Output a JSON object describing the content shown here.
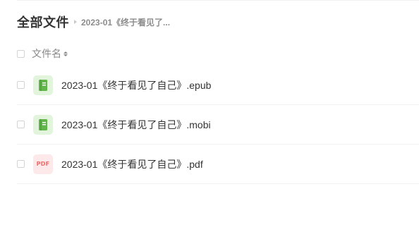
{
  "breadcrumb": {
    "root": "全部文件",
    "current": "2023-01《终于看见了..."
  },
  "table": {
    "name_header": "文件名"
  },
  "files": [
    {
      "name": "2023-01《终于看见了自己》.epub",
      "type": "book-icon"
    },
    {
      "name": "2023-01《终于看见了自己》.mobi",
      "type": "book-icon"
    },
    {
      "name": "2023-01《终于看见了自己》.pdf",
      "type": "pdf-icon",
      "icon_text": "PDF"
    }
  ],
  "colors": {
    "book_icon_bg": "#e3f4dc",
    "book_icon_fg": "#62b54a",
    "pdf_icon_bg": "#fde9ea",
    "pdf_icon_fg": "#f06a6a"
  }
}
